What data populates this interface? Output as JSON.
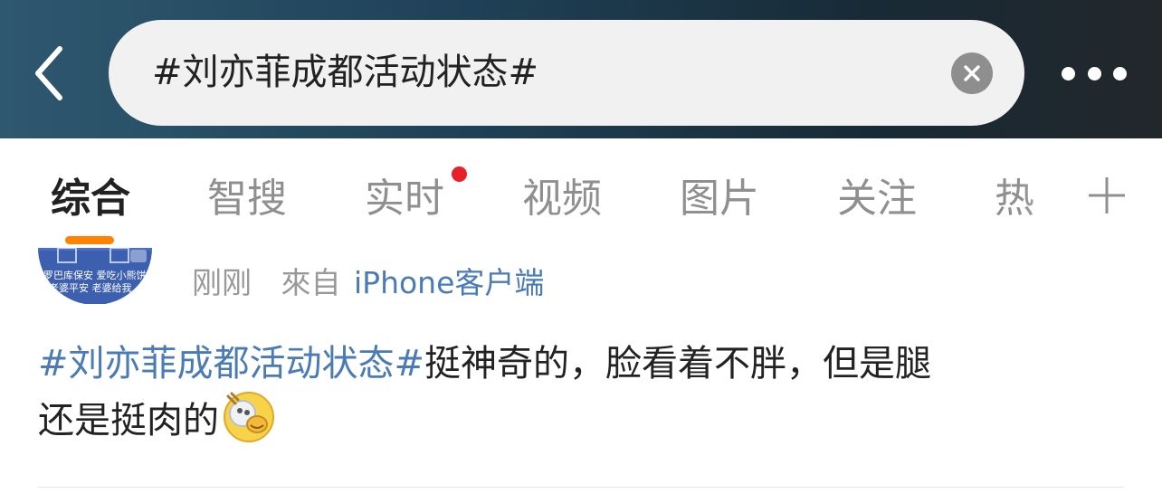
{
  "search": {
    "query": "#刘亦菲成都活动状态#",
    "back_icon": "chevron-left-icon",
    "clear_icon": "close-icon",
    "more_icon": "more-dots-icon"
  },
  "tabs": {
    "items": [
      {
        "label": "综合",
        "active": true
      },
      {
        "label": "智搜",
        "active": false
      },
      {
        "label": "实时",
        "active": false,
        "has_new_dot": true
      },
      {
        "label": "视频",
        "active": false
      },
      {
        "label": "图片",
        "active": false
      },
      {
        "label": "关注",
        "active": false
      },
      {
        "label": "热",
        "active": false
      }
    ],
    "add_icon": "plus-icon"
  },
  "post": {
    "avatar_text_line1": "罗巴库保安 爱吃小熊饼",
    "avatar_text_line2": "老婆平安 老婆给我",
    "time": "刚刚",
    "from_label": "來自",
    "client": "iPhone客户端",
    "topic": "#刘亦菲成都活动状态#",
    "body_line1": "挺神奇的，脸看着不胖，但是腿",
    "body_line2": "还是挺肉的",
    "emoji": "doge-laugh-emoji"
  },
  "colors": {
    "accent_orange": "#ff8200",
    "link_blue": "#4a7bb5",
    "new_dot_red": "#e8202a",
    "text_primary": "#222222",
    "text_secondary": "#999999"
  }
}
